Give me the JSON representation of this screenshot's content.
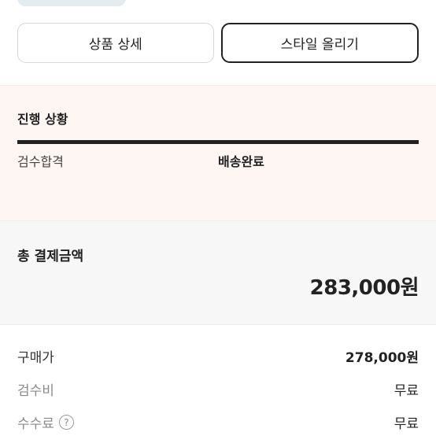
{
  "buttons": {
    "product_detail": "상품 상세",
    "upload_style": "스타일 올리기"
  },
  "status": {
    "title": "진행 상황",
    "progress": 1.0,
    "steps": [
      "검수합격",
      "배송완료"
    ]
  },
  "total": {
    "label": "총 결제금액",
    "amount": "283,000원"
  },
  "details": [
    {
      "label": "구매가",
      "value": "278,000원"
    },
    {
      "label": "검수비",
      "value": "무료"
    },
    {
      "label": "수수료",
      "value": "무료",
      "icon": "help-circle-icon"
    }
  ]
}
